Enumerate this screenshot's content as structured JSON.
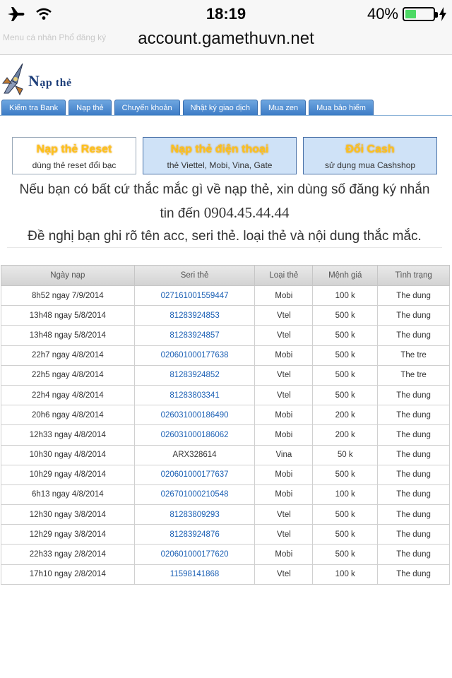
{
  "status_bar": {
    "time": "18:19",
    "battery_percent": "40%",
    "battery_level": 0.4
  },
  "browser": {
    "url": "account.gamethuvn.net",
    "ghost_breadcrumb": "Menu cá nhân  Phổ đăng ký"
  },
  "site": {
    "title_big": "N",
    "title_rest_a": "ạp ",
    "title_rest_b": "thẻ"
  },
  "tabs": [
    {
      "label": "Kiểm tra Bank"
    },
    {
      "label": "Nạp thẻ"
    },
    {
      "label": "Chuyển khoản"
    },
    {
      "label": "Nhật ký giao dịch"
    },
    {
      "label": "Mua zen"
    },
    {
      "label": "Mua bảo hiểm"
    }
  ],
  "options": [
    {
      "title": "Nạp thẻ Reset",
      "subtitle": "dùng thẻ reset đổi bạc"
    },
    {
      "title": "Nạp thẻ điện thoại",
      "subtitle": "thẻ Viettel, Mobi, Vina, Gate"
    },
    {
      "title": "Đổi Cash",
      "subtitle": "sử dụng mua Cashshop"
    }
  ],
  "info": {
    "line1": "Nếu bạn có bất cứ thắc mắc gì về nạp thẻ, xin dùng số đăng ký nhắn",
    "line2_prefix": "tin đến ",
    "phone": "0904.45.44.44",
    "line3": "Đề nghị bạn ghi rõ tên acc, seri thẻ. loại thẻ và nội dung thắc mắc."
  },
  "table": {
    "headers": [
      "Ngày nạp",
      "Seri thẻ",
      "Loại thẻ",
      "Mệnh giá",
      "Tình trạng"
    ],
    "rows": [
      [
        "8h52 ngay 7/9/2014",
        "027161001559447",
        "Mobi",
        "100 k",
        "The dung"
      ],
      [
        "13h48 ngay 5/8/2014",
        "81283924853",
        "Vtel",
        "500 k",
        "The dung"
      ],
      [
        "13h48 ngay 5/8/2014",
        "81283924857",
        "Vtel",
        "500 k",
        "The dung"
      ],
      [
        "22h7 ngay 4/8/2014",
        "020601000177638",
        "Mobi",
        "500 k",
        "The tre"
      ],
      [
        "22h5 ngay 4/8/2014",
        "81283924852",
        "Vtel",
        "500 k",
        "The tre"
      ],
      [
        "22h4 ngay 4/8/2014",
        "81283803341",
        "Vtel",
        "500 k",
        "The dung"
      ],
      [
        "20h6 ngay 4/8/2014",
        "026031000186490",
        "Mobi",
        "200 k",
        "The dung"
      ],
      [
        "12h33 ngay 4/8/2014",
        "026031000186062",
        "Mobi",
        "200 k",
        "The dung"
      ],
      [
        "10h30 ngay 4/8/2014",
        "ARX328614",
        "Vina",
        "50 k",
        "The dung"
      ],
      [
        "10h29 ngay 4/8/2014",
        "020601000177637",
        "Mobi",
        "500 k",
        "The dung"
      ],
      [
        "6h13 ngay 4/8/2014",
        "026701000210548",
        "Mobi",
        "100 k",
        "The dung"
      ],
      [
        "12h30 ngay 3/8/2014",
        "81283809293",
        "Vtel",
        "500 k",
        "The dung"
      ],
      [
        "12h29 ngay 3/8/2014",
        "81283924876",
        "Vtel",
        "500 k",
        "The dung"
      ],
      [
        "22h33 ngay 2/8/2014",
        "020601000177620",
        "Mobi",
        "500 k",
        "The dung"
      ],
      [
        "17h10 ngay 2/8/2014",
        "11598141868",
        "Vtel",
        "100 k",
        "The dung"
      ]
    ],
    "seri_is_link": [
      true,
      true,
      true,
      true,
      true,
      true,
      true,
      true,
      false,
      true,
      true,
      true,
      true,
      true,
      true
    ]
  },
  "colors": {
    "tab_blue": "#4a88cf",
    "option_title_yellow": "#ffc21a",
    "link_blue": "#1a5fb4",
    "title_navy": "#1e3f7a"
  }
}
